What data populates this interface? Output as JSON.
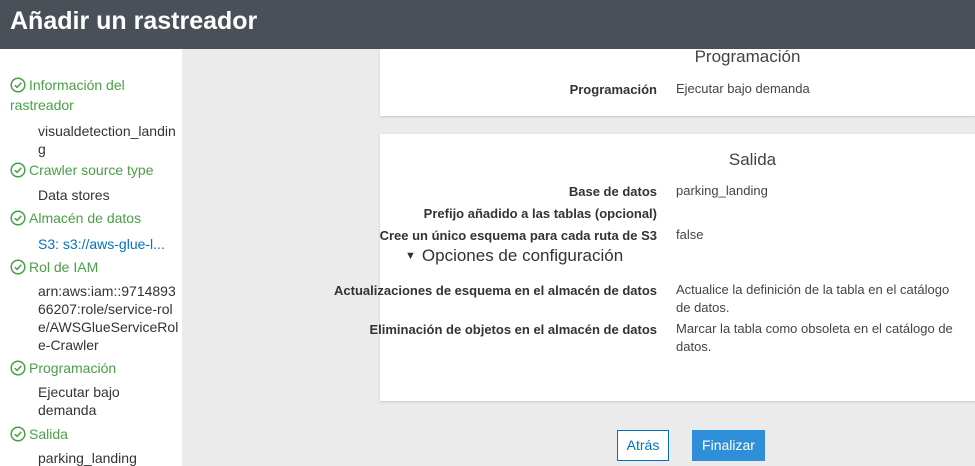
{
  "header": {
    "title": "Añadir un rastreador"
  },
  "sidebar": {
    "steps": [
      {
        "label": "Información del rastreador",
        "value": "visualdetection_landing"
      },
      {
        "label": "Crawler source type",
        "value": "Data stores"
      },
      {
        "label": "Almacén de datos",
        "value": "S3: s3://aws-glue-l..."
      },
      {
        "label": "Rol de IAM",
        "value": "arn:aws:iam::971489366207:role/service-role/AWSGlueServiceRole-Crawler"
      },
      {
        "label": "Programación",
        "value": "Ejecutar bajo demanda"
      },
      {
        "label": "Salida",
        "value": "parking_landing"
      }
    ]
  },
  "schedule": {
    "title": "Programación",
    "label": "Programación",
    "value": "Ejecutar bajo demanda"
  },
  "output": {
    "title": "Salida",
    "rows": [
      {
        "label": "Base de datos",
        "value": "parking_landing"
      },
      {
        "label": "Prefijo añadido a las tablas (opcional)",
        "value": ""
      },
      {
        "label": "Cree un único esquema para cada ruta de S3",
        "value": "false"
      }
    ],
    "config_toggle": "Opciones de configuración",
    "config_rows": [
      {
        "label": "Actualizaciones de esquema en el almacén de datos",
        "value": "Actualice la definición de la tabla en el catálogo de datos."
      },
      {
        "label": "Eliminación de objetos en el almacén de datos",
        "value": "Marcar la tabla como obsoleta en el catálogo de datos."
      }
    ]
  },
  "buttons": {
    "back": "Atrás",
    "finish": "Finalizar"
  },
  "colors": {
    "header_bg": "#4a5058",
    "step_green": "#49a046",
    "link_blue": "#0073bb",
    "primary_button": "#2e8fd8"
  },
  "icons": {
    "step_icon": "check-circle-icon",
    "expand_icon": "caret-down-icon"
  }
}
